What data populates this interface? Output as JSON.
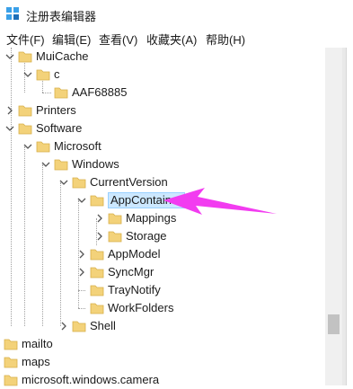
{
  "window": {
    "title": "注册表编辑器"
  },
  "menu": [
    {
      "label": "文件(F)"
    },
    {
      "label": "编辑(E)"
    },
    {
      "label": "查看(V)"
    },
    {
      "label": "收藏夹(A)"
    },
    {
      "label": "帮助(H)"
    }
  ],
  "tree": {
    "nodes": [
      {
        "label": "MuiCache",
        "state": "expanded"
      },
      {
        "label": "c",
        "state": "expanded"
      },
      {
        "label": "AAF68885",
        "state": "leaf"
      },
      {
        "label": "Printers",
        "state": "collapsed"
      },
      {
        "label": "Software",
        "state": "expanded"
      },
      {
        "label": "Microsoft",
        "state": "expanded"
      },
      {
        "label": "Windows",
        "state": "expanded"
      },
      {
        "label": "CurrentVersion",
        "state": "expanded"
      },
      {
        "label": "AppContainer",
        "state": "expanded",
        "selected": true
      },
      {
        "label": "Mappings",
        "state": "collapsed"
      },
      {
        "label": "Storage",
        "state": "collapsed"
      },
      {
        "label": "AppModel",
        "state": "collapsed"
      },
      {
        "label": "SyncMgr",
        "state": "collapsed"
      },
      {
        "label": "TrayNotify",
        "state": "leaf"
      },
      {
        "label": "WorkFolders",
        "state": "leaf"
      },
      {
        "label": "Shell",
        "state": "collapsed"
      },
      {
        "label": "mailto",
        "state": "leaf"
      },
      {
        "label": "maps",
        "state": "leaf"
      },
      {
        "label": "microsoft.windows.camera",
        "state": "leaf"
      }
    ]
  },
  "colors": {
    "folder": "#f3d27a",
    "selection": "#cce8ff",
    "annotation_arrow": "#f23cf0"
  },
  "icons": {
    "app": "registry-editor-icon",
    "folder": "folder-icon",
    "expanded": "chevron-down-icon",
    "collapsed": "chevron-right-icon",
    "annotation": "pointer-arrow-icon"
  }
}
